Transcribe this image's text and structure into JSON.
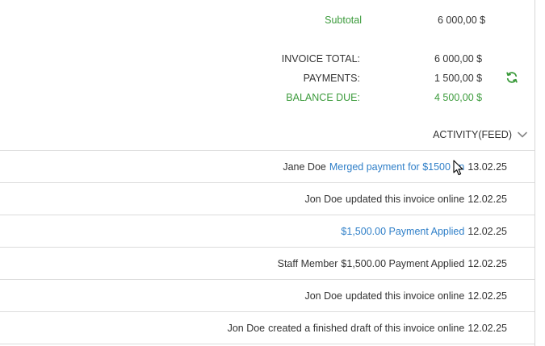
{
  "totals": {
    "subtotal_label": "Subtotal",
    "subtotal_value": "6 000,00 $",
    "invoice_total_label": "INVOICE TOTAL:",
    "invoice_total_value": "6 000,00 $",
    "payments_label": "PAYMENTS:",
    "payments_value": "1 500,00 $",
    "balance_due_label": "BALANCE DUE:",
    "balance_due_value": "4 500,00 $"
  },
  "activity": {
    "header_label": "ACTIVITY(FEED)",
    "rows": [
      {
        "actor": "Jane Doe",
        "link": "Merged payment for $1500 on",
        "text": "",
        "date": "13.02.25"
      },
      {
        "actor": "Jon Doe",
        "link": "",
        "text": "updated this invoice online",
        "date": "12.02.25"
      },
      {
        "actor": "",
        "link": "$1,500.00 Payment Applied",
        "text": "",
        "date": "12.02.25"
      },
      {
        "actor": "Staff Member",
        "link": "",
        "text": "$1,500.00 Payment Applied",
        "date": "12.02.25"
      },
      {
        "actor": "Jon Doe",
        "link": "",
        "text": "updated this invoice online",
        "date": "12.02.25"
      },
      {
        "actor": "Jon Doe",
        "link": "",
        "text": "created a finished draft of this invoice online",
        "date": "12.02.25"
      }
    ]
  },
  "icons": {
    "refresh": "refresh-icon",
    "chevron": "chevron-down-icon",
    "cursor": "mouse-cursor"
  },
  "colors": {
    "green": "#3c9b3c",
    "link": "#2f7fc8",
    "text": "#333333",
    "divider": "#dcdcdc"
  }
}
